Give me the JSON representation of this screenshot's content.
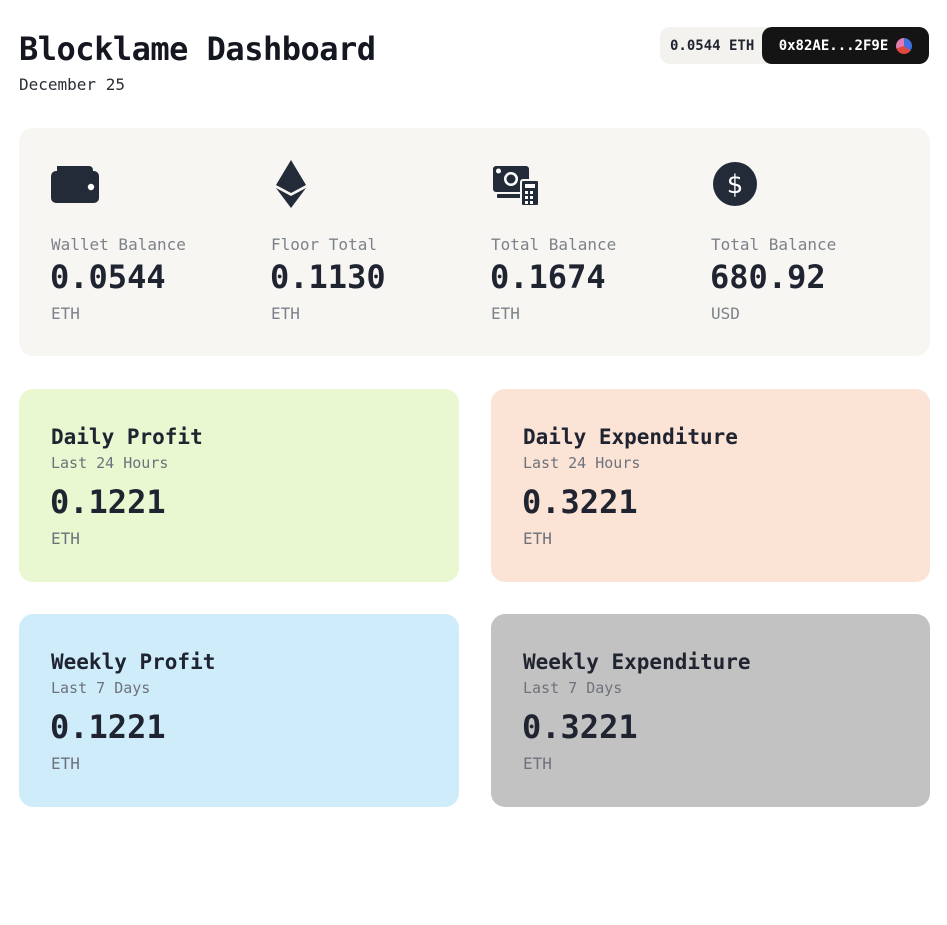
{
  "header": {
    "title": "Blocklame Dashboard",
    "date": "December 25"
  },
  "wallet": {
    "balance": "0.0544 ETH",
    "address": "0x82AE...2F9E"
  },
  "summary": [
    {
      "icon": "wallet-icon",
      "label": "Wallet Balance",
      "value": "0.0544",
      "unit": "ETH"
    },
    {
      "icon": "ethereum-icon",
      "label": "Floor Total",
      "value": "0.1130",
      "unit": "ETH"
    },
    {
      "icon": "cash-calculator-icon",
      "label": "Total Balance",
      "value": "0.1674",
      "unit": "ETH"
    },
    {
      "icon": "dollar-icon",
      "label": "Total Balance",
      "value": "680.92",
      "unit": "USD"
    }
  ],
  "cards": [
    {
      "title": "Daily Profit",
      "subtitle": "Last 24 Hours",
      "value": "0.1221",
      "unit": "ETH",
      "color": "#e9f8d0"
    },
    {
      "title": "Daily Expenditure",
      "subtitle": "Last 24 Hours",
      "value": "0.3221",
      "unit": "ETH",
      "color": "#fbe3d6"
    },
    {
      "title": "Weekly Profit",
      "subtitle": "Last 7 Days",
      "value": "0.1221",
      "unit": "ETH",
      "color": "#cfecfb"
    },
    {
      "title": "Weekly Expenditure",
      "subtitle": "Last 7 Days",
      "value": "0.3221",
      "unit": "ETH",
      "color": "#c2c2c2"
    }
  ]
}
